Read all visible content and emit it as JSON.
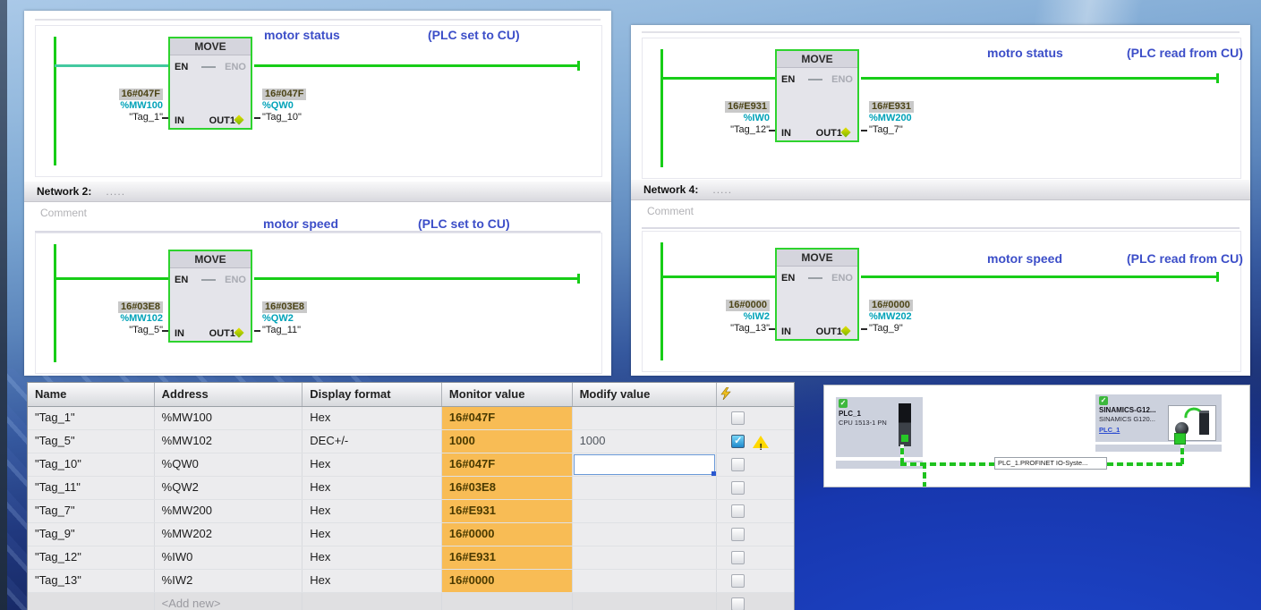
{
  "colors": {
    "ladder_green": "#17cd17",
    "address_teal": "#00a2b8",
    "comment_blue": "#3c4ec8",
    "monitor_orange": "#f8bc55",
    "value_badge_gray": "#c9c9c9",
    "wallpaper_dark_blue": "#14245e"
  },
  "move_block": {
    "title": "MOVE",
    "en": "EN",
    "eno": "ENO",
    "in": "IN",
    "out": "OUT1"
  },
  "networks": [
    {
      "title": "motor status",
      "note": "(PLC set to CU)",
      "in": {
        "value": "16#047F",
        "address": "%MW100",
        "tag": "\"Tag_1\""
      },
      "out": {
        "value": "16#047F",
        "address": "%QW0",
        "tag": "\"Tag_10\""
      }
    },
    {
      "header": "Network 2:",
      "header_dots": ".....",
      "comment_placeholder": "Comment",
      "title": "motor speed",
      "note": "(PLC set to CU)",
      "in": {
        "value": "16#03E8",
        "address": "%MW102",
        "tag": "\"Tag_5\""
      },
      "out": {
        "value": "16#03E8",
        "address": "%QW2",
        "tag": "\"Tag_11\""
      }
    },
    {
      "title": "motro status",
      "note": "(PLC read from CU)",
      "in": {
        "value": "16#E931",
        "address": "%IW0",
        "tag": "\"Tag_12\""
      },
      "out": {
        "value": "16#E931",
        "address": "%MW200",
        "tag": "\"Tag_7\""
      }
    },
    {
      "header": "Network 4:",
      "header_dots": ".....",
      "comment_placeholder": "Comment",
      "title": "motor speed",
      "note": "(PLC read from CU)",
      "in": {
        "value": "16#0000",
        "address": "%IW2",
        "tag": "\"Tag_13\""
      },
      "out": {
        "value": "16#0000",
        "address": "%MW202",
        "tag": "\"Tag_9\""
      }
    }
  ],
  "watch_table": {
    "columns": [
      "Name",
      "Address",
      "Display format",
      "Monitor value",
      "Modify value"
    ],
    "rows": [
      {
        "name": "\"Tag_1\"",
        "address": "%MW100",
        "format": "Hex",
        "monitor": "16#047F",
        "modify": ""
      },
      {
        "name": "\"Tag_5\"",
        "address": "%MW102",
        "format": "DEC+/-",
        "monitor": "1000",
        "modify": "1000"
      },
      {
        "name": "\"Tag_10\"",
        "address": "%QW0",
        "format": "Hex",
        "monitor": "16#047F",
        "modify": ""
      },
      {
        "name": "\"Tag_11\"",
        "address": "%QW2",
        "format": "Hex",
        "monitor": "16#03E8",
        "modify": ""
      },
      {
        "name": "\"Tag_7\"",
        "address": "%MW200",
        "format": "Hex",
        "monitor": "16#E931",
        "modify": ""
      },
      {
        "name": "\"Tag_9\"",
        "address": "%MW202",
        "format": "Hex",
        "monitor": "16#0000",
        "modify": ""
      },
      {
        "name": "\"Tag_12\"",
        "address": "%IW0",
        "format": "Hex",
        "monitor": "16#E931",
        "modify": ""
      },
      {
        "name": "\"Tag_13\"",
        "address": "%IW2",
        "format": "Hex",
        "monitor": "16#0000",
        "modify": ""
      }
    ],
    "add_new": "<Add new>"
  },
  "network_view": {
    "plc_name": "PLC_1",
    "plc_type": "CPU 1513-1 PN",
    "drive_name": "SINAMICS-G12...",
    "drive_type": "SINAMICS G120...",
    "drive_link": "PLC_1",
    "bus_label": "PLC_1.PROFINET IO-Syste..."
  },
  "icons": {
    "check": "✓",
    "dropdown": "▼",
    "warning": "!"
  }
}
